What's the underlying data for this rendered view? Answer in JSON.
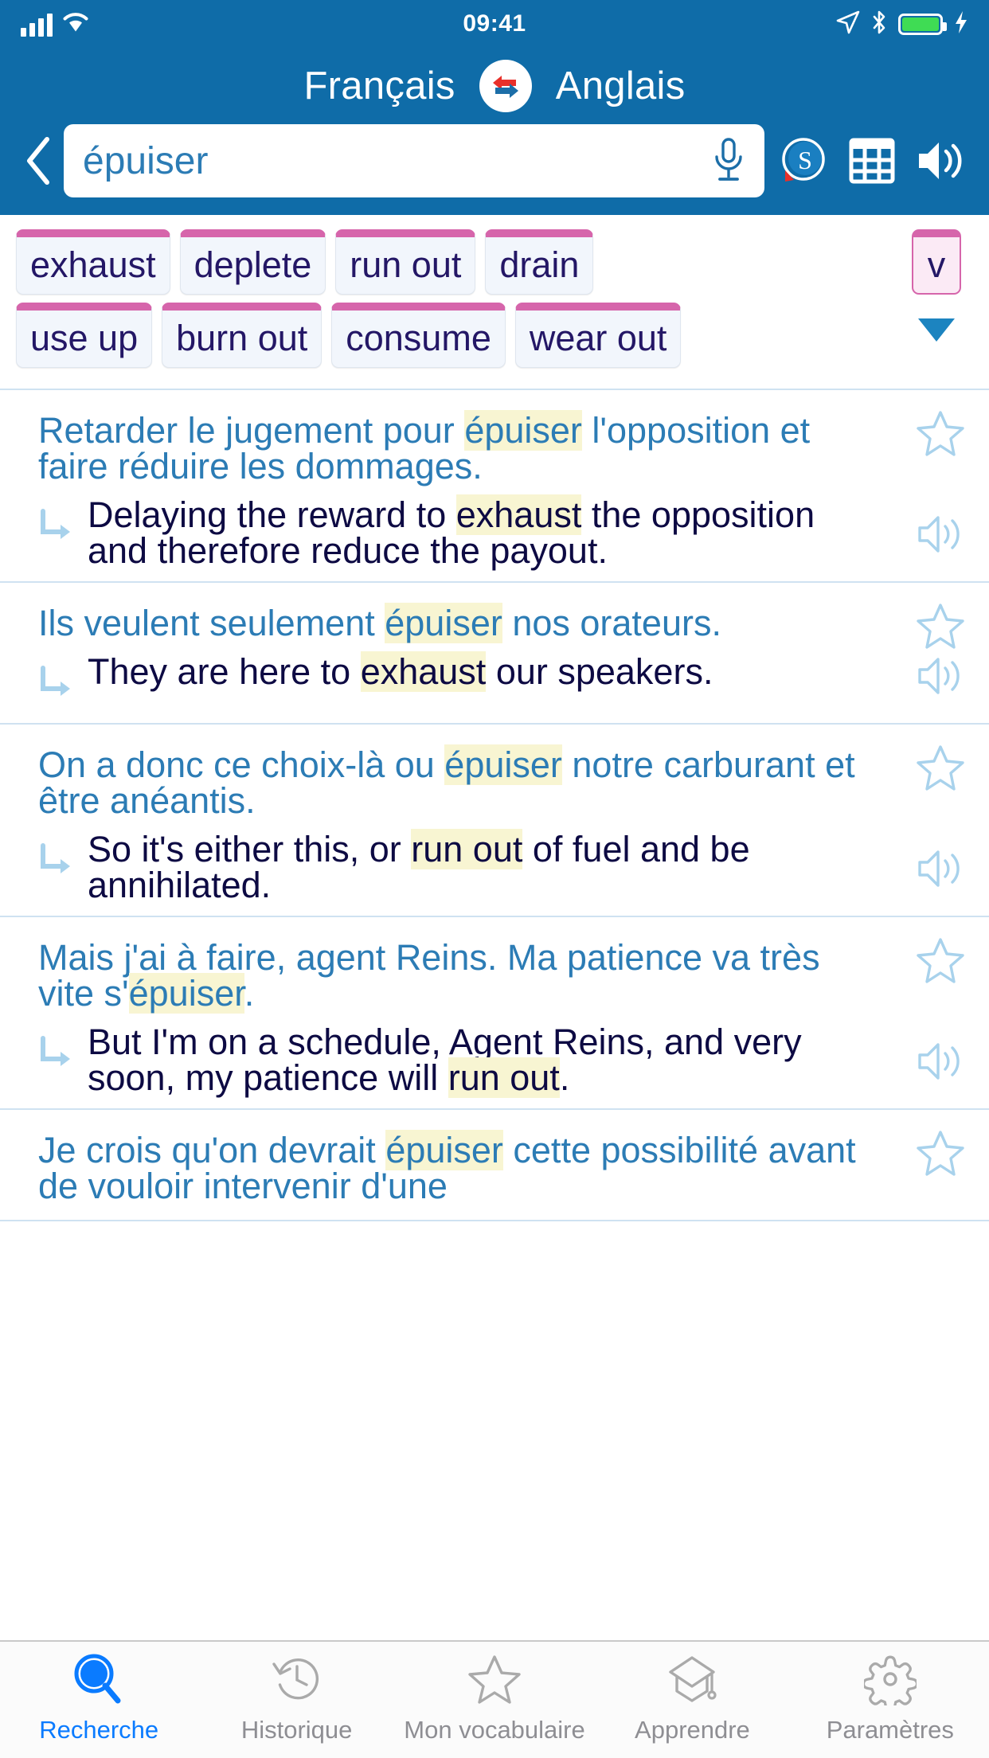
{
  "status_bar": {
    "time": "09:41",
    "icons": [
      "signal-bars-icon",
      "wifi-icon",
      "location-arrow-icon",
      "bluetooth-icon",
      "battery-icon",
      "charging-bolt-icon"
    ]
  },
  "header": {
    "source_language": "Français",
    "target_language": "Anglais",
    "swap_icon": "swap-languages-icon",
    "back_icon": "back-chevron-icon",
    "search_value": "épuiser",
    "search_placeholder": "épuiser",
    "mic_icon": "microphone-icon",
    "actions": [
      {
        "name": "soft-dictionary-icon",
        "label": "S"
      },
      {
        "name": "conjugation-table-icon",
        "label": ""
      },
      {
        "name": "speaker-icon",
        "label": ""
      }
    ],
    "bg_color": "#0f6ca8"
  },
  "translations": {
    "pos_badge": "v",
    "expand_icon": "chevron-down-icon",
    "rows": [
      [
        "exhaust",
        "deplete",
        "run out",
        "drain"
      ],
      [
        "use up",
        "burn out",
        "consume",
        "wear out"
      ]
    ],
    "chip_accent_color": "#d665ab"
  },
  "results": [
    {
      "source_parts": [
        {
          "t": "Retarder le jugement pour ",
          "hl": false
        },
        {
          "t": "épuiser",
          "hl": true
        },
        {
          "t": " l'opposition et faire réduire les dommages.",
          "hl": false
        }
      ],
      "target_parts": [
        {
          "t": "Delaying the reward to ",
          "hl": false
        },
        {
          "t": "exhaust",
          "hl": true
        },
        {
          "t": " the opposition and therefore reduce the payout.",
          "hl": false
        }
      ],
      "favorite_icon": "star-outline-icon",
      "speaker_icon": "speaker-icon"
    },
    {
      "source_parts": [
        {
          "t": "Ils veulent seulement ",
          "hl": false
        },
        {
          "t": "épuiser",
          "hl": true
        },
        {
          "t": " nos orateurs.",
          "hl": false
        }
      ],
      "target_parts": [
        {
          "t": "They are here to ",
          "hl": false
        },
        {
          "t": "exhaust",
          "hl": true
        },
        {
          "t": " our speakers.",
          "hl": false
        }
      ],
      "favorite_icon": "star-outline-icon",
      "speaker_icon": "speaker-icon"
    },
    {
      "source_parts": [
        {
          "t": "On a donc ce choix-là ou ",
          "hl": false
        },
        {
          "t": "épuiser",
          "hl": true
        },
        {
          "t": " notre carburant et être anéantis.",
          "hl": false
        }
      ],
      "target_parts": [
        {
          "t": "So it's either this, or ",
          "hl": false
        },
        {
          "t": "run out",
          "hl": true
        },
        {
          "t": " of fuel and be annihilated.",
          "hl": false
        }
      ],
      "favorite_icon": "star-outline-icon",
      "speaker_icon": "speaker-icon"
    },
    {
      "source_parts": [
        {
          "t": "Mais j'ai à faire, agent Reins. Ma patience va très vite s'",
          "hl": false
        },
        {
          "t": "épuiser",
          "hl": true
        },
        {
          "t": ".",
          "hl": false
        }
      ],
      "target_parts": [
        {
          "t": "But I'm on a schedule, Agent Reins, and very soon, my patience will ",
          "hl": false
        },
        {
          "t": "run out",
          "hl": true
        },
        {
          "t": ".",
          "hl": false
        }
      ],
      "favorite_icon": "star-outline-icon",
      "speaker_icon": "speaker-icon"
    },
    {
      "source_parts": [
        {
          "t": "Je crois qu'on devrait ",
          "hl": false
        },
        {
          "t": "épuiser",
          "hl": true
        },
        {
          "t": " cette possibilité avant de vouloir intervenir d'une",
          "hl": false
        }
      ],
      "target_parts": [],
      "favorite_icon": "star-outline-icon",
      "speaker_icon": "speaker-icon"
    }
  ],
  "tabbar": {
    "items": [
      {
        "label": "Recherche",
        "icon": "search-icon",
        "active": true
      },
      {
        "label": "Historique",
        "icon": "history-icon",
        "active": false
      },
      {
        "label": "Mon vocabulaire",
        "icon": "star-icon",
        "active": false
      },
      {
        "label": "Apprendre",
        "icon": "graduation-cap-icon",
        "active": false
      },
      {
        "label": "Paramètres",
        "icon": "gear-icon",
        "active": false
      }
    ],
    "active_color": "#0a7bff",
    "inactive_color": "#8e8e93"
  }
}
